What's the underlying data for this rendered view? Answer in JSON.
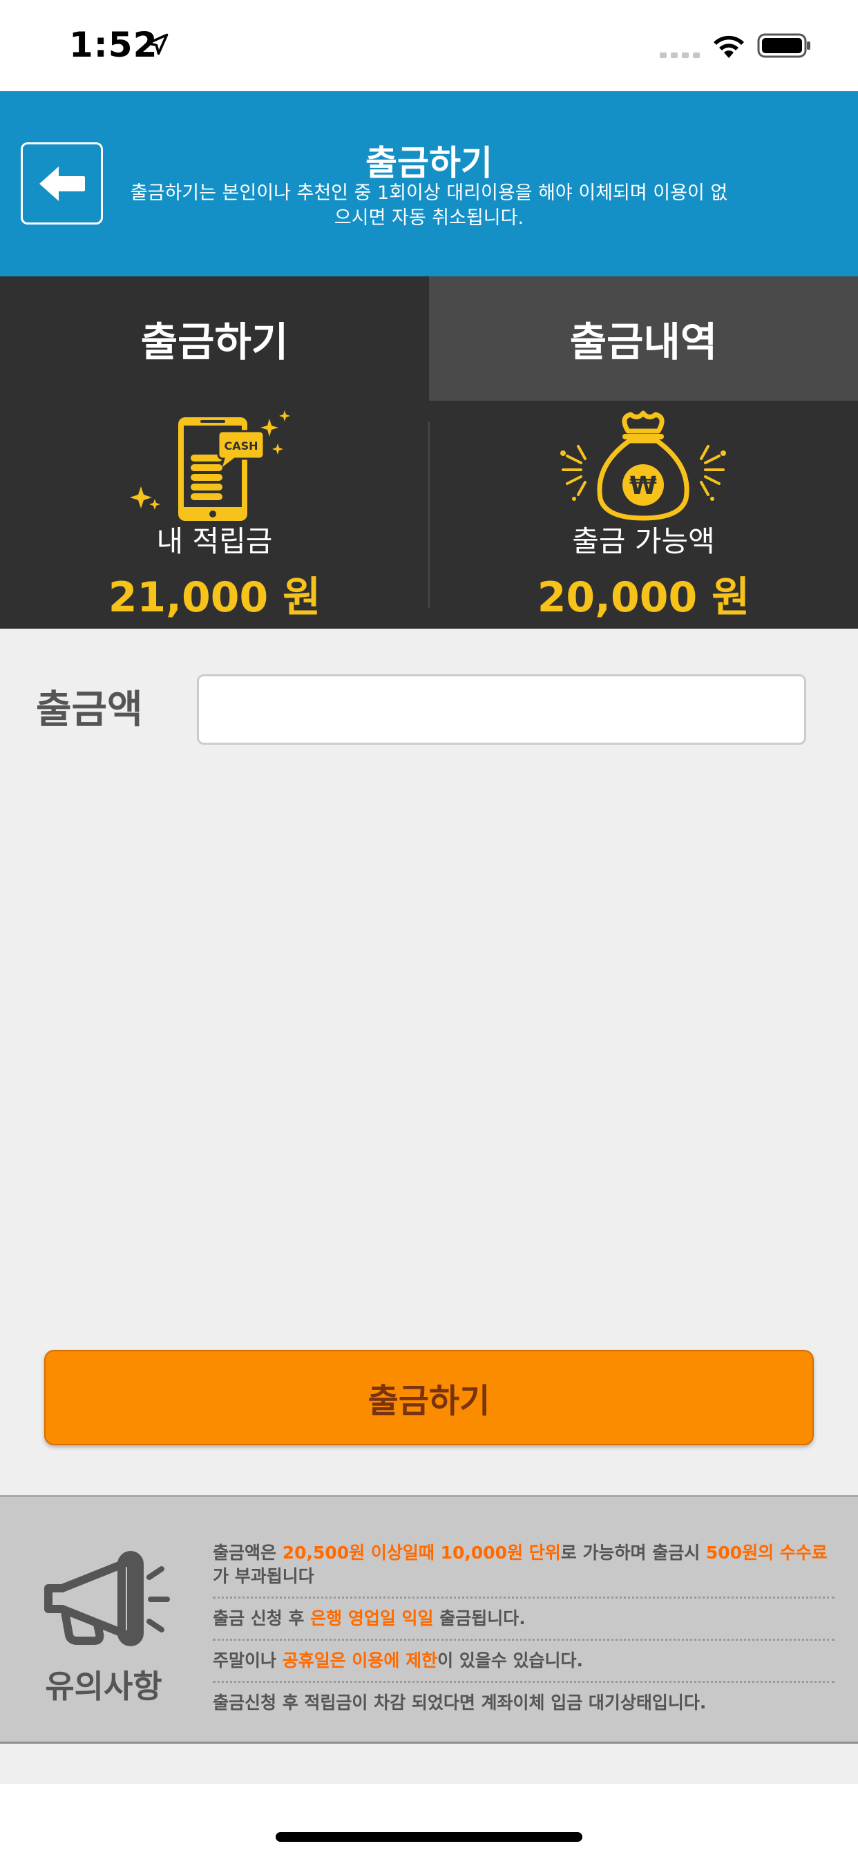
{
  "status_bar": {
    "time": "1:52",
    "icons": [
      "location-arrow-icon",
      "cellular-signal-icon",
      "wifi-icon",
      "battery-icon"
    ]
  },
  "header": {
    "back_icon": "arrow-left-icon",
    "title": "출금하기",
    "description": "출금하기는 본인이나 추천인 중 1회이상 대리이용을 해야 이체되며 이용이 없으시면 자동 취소됩니다.",
    "background_color": "#1590c6"
  },
  "tabs": [
    {
      "label": "출금하기",
      "active": true
    },
    {
      "label": "출금내역",
      "active": false
    }
  ],
  "balance": {
    "my_points": {
      "icon": "phone-cash-icon",
      "label": "내 적립금",
      "amount": "21,000 원"
    },
    "available": {
      "icon": "money-bag-won-icon",
      "label": "출금 가능액",
      "amount": "20,000 원"
    },
    "amount_color": "#f7c31a"
  },
  "form": {
    "amount_label": "출금액",
    "amount_value": "",
    "amount_placeholder": ""
  },
  "submit": {
    "label": "출금하기",
    "color": "#fb8c00"
  },
  "notice": {
    "icon": "megaphone-icon",
    "title": "유의사항",
    "items": [
      {
        "parts": [
          {
            "text": "출금액은 ",
            "hl": false
          },
          {
            "text": "20,500원 이상일때 10,000원 단위",
            "hl": true
          },
          {
            "text": "로 가능하며 출금시 ",
            "hl": false
          },
          {
            "text": "500원의 수수료",
            "hl": true
          },
          {
            "text": "가 부과됩니다",
            "hl": false
          }
        ]
      },
      {
        "parts": [
          {
            "text": "출금 신청 후 ",
            "hl": false
          },
          {
            "text": "은행 영업일 익일",
            "hl": true
          },
          {
            "text": " 출금됩니다.",
            "hl": false
          }
        ]
      },
      {
        "parts": [
          {
            "text": "주말이나 ",
            "hl": false
          },
          {
            "text": "공휴일은 이용에 제한",
            "hl": true
          },
          {
            "text": "이 있을수 있습니다.",
            "hl": false
          }
        ]
      },
      {
        "parts": [
          {
            "text": "출금신청 후 적립금이 차감 되었다면 계좌이체 입금 대기상태입니다.",
            "hl": false
          }
        ]
      }
    ],
    "highlight_color": "#ff6a00"
  }
}
